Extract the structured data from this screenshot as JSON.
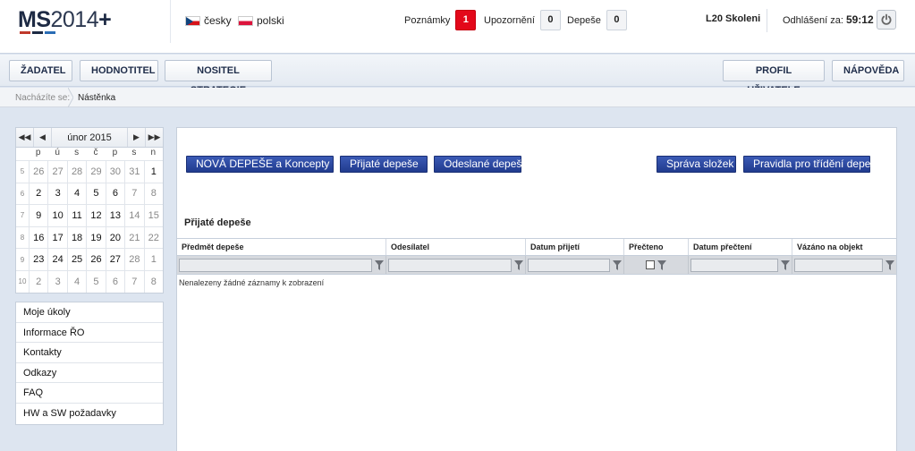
{
  "header": {
    "logo": {
      "ms": "MS",
      "year": "2014",
      "plus": "+",
      "stripe_colors": [
        "#c0392b",
        "#1d2a44",
        "#2a6db5"
      ]
    },
    "languages": [
      {
        "label": "česky"
      },
      {
        "label": "polski"
      }
    ],
    "counters": [
      {
        "label": "Poznámky",
        "value": "1"
      },
      {
        "label": "Upozornění",
        "value": "0"
      },
      {
        "label": "Depeše",
        "value": "0"
      }
    ],
    "user": "L20 Skoleni",
    "logout_label": "Odhlášení za:",
    "logout_time": "59:12"
  },
  "nav": {
    "left": [
      "ŽADATEL",
      "HODNOTITEL",
      "NOSITEL STRATEGIE"
    ],
    "right": [
      "PROFIL UŽIVATELE",
      "NÁPOVĚDA"
    ]
  },
  "breadcrumb": {
    "label": "Nacházíte se:",
    "current": "Nástěnka"
  },
  "calendar": {
    "nav_first": "◀◀",
    "nav_prev": "◀",
    "nav_next": "▶",
    "nav_last": "▶▶",
    "month": "únor 2015",
    "dow": [
      "p",
      "ú",
      "s",
      "č",
      "p",
      "s",
      "n"
    ],
    "weeks": [
      {
        "wk": "5",
        "days": [
          {
            "d": "26",
            "o": true
          },
          {
            "d": "27",
            "o": true
          },
          {
            "d": "28",
            "o": true
          },
          {
            "d": "29",
            "o": true
          },
          {
            "d": "30",
            "o": true
          },
          {
            "d": "31",
            "o": true
          },
          {
            "d": "1",
            "o": false
          }
        ]
      },
      {
        "wk": "6",
        "days": [
          {
            "d": "2",
            "o": false
          },
          {
            "d": "3",
            "o": false
          },
          {
            "d": "4",
            "o": false
          },
          {
            "d": "5",
            "o": false
          },
          {
            "d": "6",
            "o": false
          },
          {
            "d": "7",
            "o": true
          },
          {
            "d": "8",
            "o": true
          }
        ]
      },
      {
        "wk": "7",
        "days": [
          {
            "d": "9",
            "o": false
          },
          {
            "d": "10",
            "o": false
          },
          {
            "d": "11",
            "o": false
          },
          {
            "d": "12",
            "o": false
          },
          {
            "d": "13",
            "o": false
          },
          {
            "d": "14",
            "o": true
          },
          {
            "d": "15",
            "o": true
          }
        ]
      },
      {
        "wk": "8",
        "days": [
          {
            "d": "16",
            "o": false
          },
          {
            "d": "17",
            "o": false
          },
          {
            "d": "18",
            "o": false
          },
          {
            "d": "19",
            "o": false
          },
          {
            "d": "20",
            "o": false
          },
          {
            "d": "21",
            "o": true
          },
          {
            "d": "22",
            "o": true
          }
        ]
      },
      {
        "wk": "9",
        "days": [
          {
            "d": "23",
            "o": false
          },
          {
            "d": "24",
            "o": false
          },
          {
            "d": "25",
            "o": false
          },
          {
            "d": "26",
            "o": false
          },
          {
            "d": "27",
            "o": false
          },
          {
            "d": "28",
            "o": true
          },
          {
            "d": "1",
            "o": true
          }
        ]
      },
      {
        "wk": "10",
        "days": [
          {
            "d": "2",
            "o": true
          },
          {
            "d": "3",
            "o": true
          },
          {
            "d": "4",
            "o": true
          },
          {
            "d": "5",
            "o": true
          },
          {
            "d": "6",
            "o": true
          },
          {
            "d": "7",
            "o": true
          },
          {
            "d": "8",
            "o": true
          }
        ]
      }
    ]
  },
  "side_menu": [
    "Moje úkoly",
    "Informace ŘO",
    "Kontakty",
    "Odkazy",
    "FAQ",
    "HW a SW požadavky"
  ],
  "main": {
    "buttons_left": [
      "NOVÁ DEPEŠE a Koncepty",
      "Přijaté depeše",
      "Odeslané depeše"
    ],
    "buttons_right": [
      "Správa složek",
      "Pravidla pro třídění depeší"
    ],
    "section_title": "Přijaté depeše",
    "columns": [
      "Předmět depeše",
      "Odesílatel",
      "Datum přijetí",
      "Přečteno",
      "Datum přečtení",
      "Vázáno na objekt"
    ],
    "empty_message": "Nenalezeny žádné záznamy k zobrazení"
  },
  "colors": {
    "accent": "#2a3f99",
    "alert": "#e3081a"
  }
}
